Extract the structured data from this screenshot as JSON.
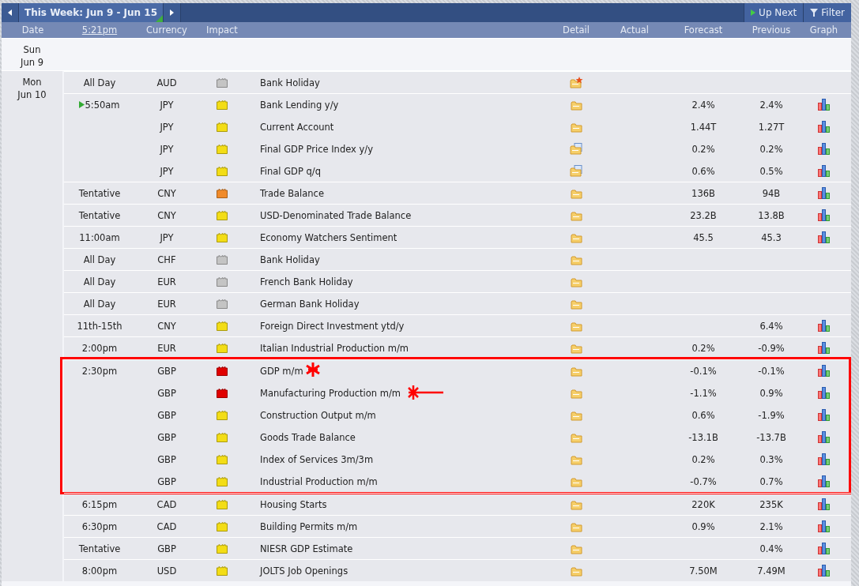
{
  "toolbar": {
    "title": "This Week: Jun 9 - Jun 15",
    "buttons": [
      "Up Next",
      "Filter"
    ]
  },
  "columns": [
    "Date",
    "5:21pm",
    "Currency",
    "Impact",
    "Detail",
    "Actual",
    "Forecast",
    "Previous",
    "Graph"
  ],
  "days": [
    {
      "day": "Sun",
      "date": "Jun 9"
    },
    {
      "day": "Mon",
      "date": "Jun 10",
      "groups": [
        {
          "events": [
            {
              "time": "All Day",
              "currency": "AUD",
              "impact": {
                "color": "#c4c4c4"
              },
              "event": "Bank Holiday",
              "detail": {
                "kind": "folder-star"
              },
              "graph": false,
              "up_next": false
            },
            {
              "time": "5:50am",
              "currency": "JPY",
              "impact": {
                "color": "#f3dd16"
              },
              "event": "Bank Lending y/y",
              "detail": {
                "kind": "folder"
              },
              "forecast": "2.4%",
              "previous": "2.4%",
              "graph": true,
              "up_next": true
            },
            {
              "currency": "JPY",
              "impact": {
                "color": "#f3dd16"
              },
              "event": "Current Account",
              "detail": {
                "kind": "folder"
              },
              "forecast": "1.44T",
              "previous": "1.27T",
              "graph": true,
              "up_next": false
            },
            {
              "currency": "JPY",
              "impact": {
                "color": "#f3dd16"
              },
              "event": "Final GDP Price Index y/y",
              "detail": {
                "kind": "folder-doc"
              },
              "forecast": "0.2%",
              "previous": "0.2%",
              "graph": true,
              "up_next": false
            },
            {
              "currency": "JPY",
              "impact": {
                "color": "#f3dd16"
              },
              "event": "Final GDP q/q",
              "detail": {
                "kind": "folder-doc"
              },
              "forecast": "0.6%",
              "previous": "0.5%",
              "graph": true,
              "up_next": false
            },
            {
              "time": "Tentative",
              "currency": "CNY",
              "impact": {
                "color": "#f08a2a"
              },
              "event": "Trade Balance",
              "detail": {
                "kind": "folder"
              },
              "forecast": "136B",
              "previous": "94B",
              "graph": true,
              "up_next": false
            },
            {
              "time": "Tentative",
              "currency": "CNY",
              "impact": {
                "color": "#f3dd16"
              },
              "event": "USD-Denominated Trade Balance",
              "detail": {
                "kind": "folder"
              },
              "forecast": "23.2B",
              "previous": "13.8B",
              "graph": true,
              "up_next": false
            },
            {
              "time": "11:00am",
              "currency": "JPY",
              "impact": {
                "color": "#f3dd16"
              },
              "event": "Economy Watchers Sentiment",
              "detail": {
                "kind": "folder"
              },
              "forecast": "45.5",
              "previous": "45.3",
              "graph": true,
              "up_next": false
            },
            {
              "time": "All Day",
              "currency": "CHF",
              "impact": {
                "color": "#c4c4c4"
              },
              "event": "Bank Holiday",
              "detail": {
                "kind": "folder"
              },
              "graph": false,
              "up_next": false
            },
            {
              "time": "All Day",
              "currency": "EUR",
              "impact": {
                "color": "#c4c4c4"
              },
              "event": "French Bank Holiday",
              "detail": {
                "kind": "folder"
              },
              "graph": false,
              "up_next": false
            },
            {
              "time": "All Day",
              "currency": "EUR",
              "impact": {
                "color": "#c4c4c4"
              },
              "event": "German Bank Holiday",
              "detail": {
                "kind": "folder"
              },
              "graph": false,
              "up_next": false
            },
            {
              "time": "11th-15th",
              "currency": "CNY",
              "impact": {
                "color": "#f3dd16"
              },
              "event": "Foreign Direct Investment ytd/y",
              "detail": {
                "kind": "folder"
              },
              "previous": "6.4%",
              "graph": true,
              "up_next": false
            },
            {
              "time": "2:00pm",
              "currency": "EUR",
              "impact": {
                "color": "#f3dd16"
              },
              "event": "Italian Industrial Production m/m",
              "detail": {
                "kind": "folder"
              },
              "forecast": "0.2%",
              "previous": "-0.9%",
              "graph": true,
              "up_next": false
            }
          ]
        },
        {
          "frame": {
            "kind": "rectangle"
          },
          "events": [
            {
              "time": "2:30pm",
              "currency": "GBP",
              "impact": {
                "color": "#e00000"
              },
              "event": "GDP m/m",
              "mark": {
                "kind": "star"
              },
              "detail": {
                "kind": "folder"
              },
              "forecast": "-0.1%",
              "previous": "-0.1%",
              "graph": true,
              "up_next": false
            },
            {
              "currency": "GBP",
              "impact": {
                "color": "#e00000"
              },
              "event": "Manufacturing Production m/m",
              "mark": {
                "kind": "star-arrow"
              },
              "detail": {
                "kind": "folder"
              },
              "forecast": "-1.1%",
              "previous": "0.9%",
              "graph": true,
              "up_next": false
            },
            {
              "currency": "GBP",
              "impact": {
                "color": "#f3dd16"
              },
              "event": "Construction Output m/m",
              "detail": {
                "kind": "folder"
              },
              "forecast": "0.6%",
              "previous": "-1.9%",
              "graph": true,
              "up_next": false
            },
            {
              "currency": "GBP",
              "impact": {
                "color": "#f3dd16"
              },
              "event": "Goods Trade Balance",
              "detail": {
                "kind": "folder"
              },
              "forecast": "-13.1B",
              "previous": "-13.7B",
              "graph": true,
              "up_next": false
            },
            {
              "currency": "GBP",
              "impact": {
                "color": "#f3dd16"
              },
              "event": "Index of Services 3m/3m",
              "detail": {
                "kind": "folder"
              },
              "forecast": "0.2%",
              "previous": "0.3%",
              "graph": true,
              "up_next": false
            },
            {
              "currency": "GBP",
              "impact": {
                "color": "#f3dd16"
              },
              "event": "Industrial Production m/m",
              "detail": {
                "kind": "folder"
              },
              "forecast": "-0.7%",
              "previous": "0.7%",
              "graph": true,
              "up_next": false
            }
          ]
        },
        {
          "events": [
            {
              "time": "6:15pm",
              "currency": "CAD",
              "impact": {
                "color": "#f3dd16"
              },
              "event": "Housing Starts",
              "detail": {
                "kind": "folder"
              },
              "forecast": "220K",
              "previous": "235K",
              "graph": true,
              "up_next": false
            },
            {
              "time": "6:30pm",
              "currency": "CAD",
              "impact": {
                "color": "#f3dd16"
              },
              "event": "Building Permits m/m",
              "detail": {
                "kind": "folder"
              },
              "forecast": "0.9%",
              "previous": "2.1%",
              "graph": true,
              "up_next": false
            },
            {
              "time": "Tentative",
              "currency": "GBP",
              "impact": {
                "color": "#f3dd16"
              },
              "event": "NIESR GDP Estimate",
              "detail": {
                "kind": "folder"
              },
              "previous": "0.4%",
              "graph": true,
              "up_next": false
            },
            {
              "time": "8:00pm",
              "currency": "USD",
              "impact": {
                "color": "#f3dd16"
              },
              "event": "JOLTS Job Openings",
              "detail": {
                "kind": "folder"
              },
              "forecast": "7.50M",
              "previous": "7.49M",
              "graph": true,
              "up_next": false
            }
          ]
        }
      ]
    }
  ]
}
